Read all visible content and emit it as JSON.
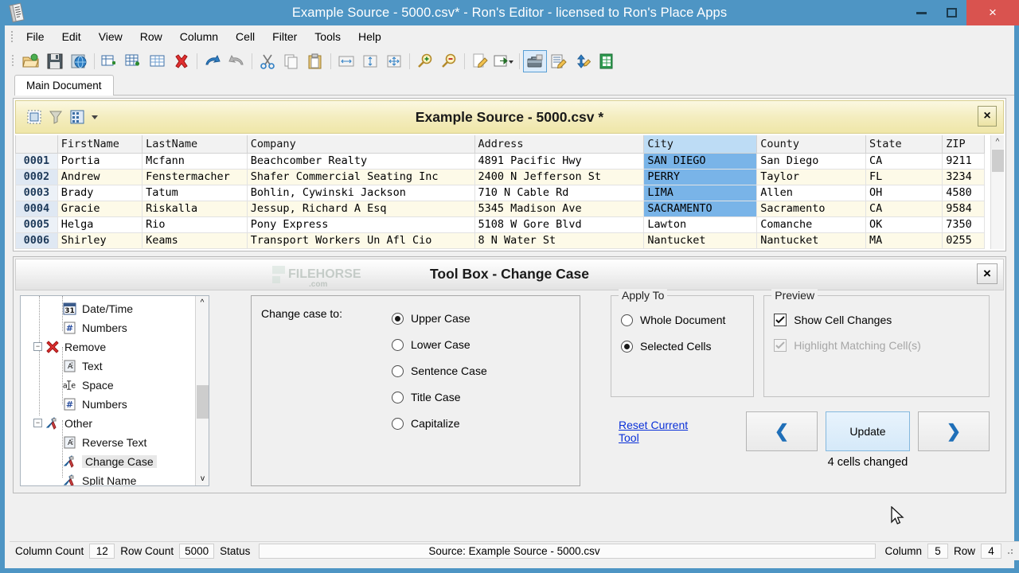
{
  "window": {
    "title": "Example Source - 5000.csv* - Ron's Editor - licensed to Ron's Place Apps",
    "titlebar_color": "#4e95c4",
    "close_color": "#d9534f",
    "minimize_label": "",
    "maximize_label": "",
    "close_label": "×"
  },
  "menu": {
    "items": [
      "File",
      "Edit",
      "View",
      "Row",
      "Column",
      "Cell",
      "Filter",
      "Tools",
      "Help"
    ]
  },
  "toolbar": {
    "groups": [
      [
        "open-icon",
        "save-icon",
        "save-as-web-icon"
      ],
      [
        "insert-column-icon",
        "insert-row-icon",
        "grid-icon",
        "delete-icon"
      ],
      [
        "undo-icon",
        "redo-icon"
      ],
      [
        "cut-icon",
        "copy-icon",
        "paste-icon"
      ],
      [
        "fit-column-icon",
        "autosize-height-icon",
        "autosize-all-icon"
      ],
      [
        "zoom-in-icon",
        "zoom-out-icon"
      ],
      [
        "edit-document-icon",
        "export-icon"
      ],
      [
        "toolbox-icon",
        "edit-cell-icon",
        "sort-icon",
        "spreadsheet-icon"
      ]
    ],
    "selected_icon": "toolbox-icon"
  },
  "tabs": {
    "items": [
      {
        "label": "Main Document",
        "active": true
      }
    ]
  },
  "document_panel": {
    "title": "Example Source - 5000.csv *",
    "close_label": "×",
    "header_buttons": [
      "select-all-icon",
      "filter-icon",
      "columns-icon"
    ]
  },
  "grid": {
    "columns": [
      "",
      "FirstName",
      "LastName",
      "Company",
      "Address",
      "City",
      "County",
      "State",
      "ZIP"
    ],
    "selected_column": "City",
    "rows": [
      {
        "num": "0001",
        "cells": [
          "Portia",
          "Mcfann",
          "Beachcomber Realty",
          "4891 Pacific Hwy",
          "SAN DIEGO",
          "San Diego",
          "CA",
          "9211"
        ],
        "selected_cell": "SAN DIEGO"
      },
      {
        "num": "0002",
        "cells": [
          "Andrew",
          "Fenstermacher",
          "Shafer Commercial Seating Inc",
          "2400 N Jefferson St",
          "PERRY",
          "Taylor",
          "FL",
          "3234"
        ],
        "selected_cell": "PERRY"
      },
      {
        "num": "0003",
        "cells": [
          "Brady",
          "Tatum",
          "Bohlin, Cywinski Jackson",
          "710 N Cable Rd",
          "LIMA",
          "Allen",
          "OH",
          "4580"
        ],
        "selected_cell": "LIMA"
      },
      {
        "num": "0004",
        "cells": [
          "Gracie",
          "Riskalla",
          "Jessup, Richard A Esq",
          "5345 Madison Ave",
          "SACRAMENTO",
          "Sacramento",
          "CA",
          "9584"
        ],
        "selected_cell": "SACRAMENTO"
      },
      {
        "num": "0005",
        "cells": [
          "Helga",
          "Rio",
          "Pony Express",
          "5108 W Gore Blvd",
          "Lawton",
          "Comanche",
          "OK",
          "7350"
        ],
        "selected_cell": ""
      },
      {
        "num": "0006",
        "cells": [
          "Shirley",
          "Keams",
          "Transport Workers Un Afl Cio",
          "8 N Water St",
          "Nantucket",
          "Nantucket",
          "MA",
          "0255"
        ],
        "selected_cell": ""
      }
    ],
    "selection_color": "#79b4e8"
  },
  "toolbox": {
    "title": "Tool Box - Change Case",
    "close_label": "×",
    "watermark": "FILEHORSE",
    "watermark_sub": ".com",
    "tree": [
      {
        "label": "Date/Time",
        "icon": "calendar-31-icon",
        "level": 2,
        "expander": "",
        "selected": false
      },
      {
        "label": "Numbers",
        "icon": "numbers-doc-icon",
        "level": 2,
        "expander": "",
        "selected": false
      },
      {
        "label": "Remove",
        "icon": "red-x-icon",
        "level": 1,
        "expander": "−",
        "selected": false
      },
      {
        "label": "Text",
        "icon": "text-doc-icon",
        "level": 2,
        "expander": "",
        "selected": false
      },
      {
        "label": "Space",
        "icon": "space-ae-icon",
        "level": 2,
        "expander": "",
        "selected": false
      },
      {
        "label": "Numbers",
        "icon": "numbers-doc-icon",
        "level": 2,
        "expander": "",
        "selected": false
      },
      {
        "label": "Other",
        "icon": "tools-icon",
        "level": 1,
        "expander": "−",
        "selected": false
      },
      {
        "label": "Reverse Text",
        "icon": "text-doc-icon",
        "level": 2,
        "expander": "",
        "selected": false
      },
      {
        "label": "Change Case",
        "icon": "tools-icon",
        "level": 2,
        "expander": "",
        "selected": true
      },
      {
        "label": "Split Name",
        "icon": "tools-icon",
        "level": 2,
        "expander": "",
        "selected": false
      }
    ],
    "change_case": {
      "label": "Change case to:",
      "options": [
        {
          "label": "Upper Case",
          "selected": true
        },
        {
          "label": "Lower Case",
          "selected": false
        },
        {
          "label": "Sentence Case",
          "selected": false
        },
        {
          "label": "Title Case",
          "selected": false
        },
        {
          "label": "Capitalize",
          "selected": false
        }
      ]
    },
    "apply_to": {
      "legend": "Apply To",
      "options": [
        {
          "label": "Whole Document",
          "selected": false
        },
        {
          "label": "Selected Cells",
          "selected": true
        }
      ]
    },
    "preview": {
      "legend": "Preview",
      "options": [
        {
          "label": "Show Cell Changes",
          "checked": true,
          "disabled": false
        },
        {
          "label": "Highlight Matching Cell(s)",
          "checked": true,
          "disabled": true
        }
      ]
    },
    "reset_link": "Reset Current Tool",
    "prev_label": "❮",
    "update_label": "Update",
    "next_label": "❯",
    "cells_changed": "4 cells changed"
  },
  "statusbar": {
    "column_count_label": "Column Count",
    "column_count_value": "12",
    "row_count_label": "Row Count",
    "row_count_value": "5000",
    "status_label": "Status",
    "status_value": "",
    "source": "Source: Example Source - 5000.csv",
    "column_label": "Column",
    "column_value": "5",
    "row_label": "Row",
    "row_value": "4"
  }
}
